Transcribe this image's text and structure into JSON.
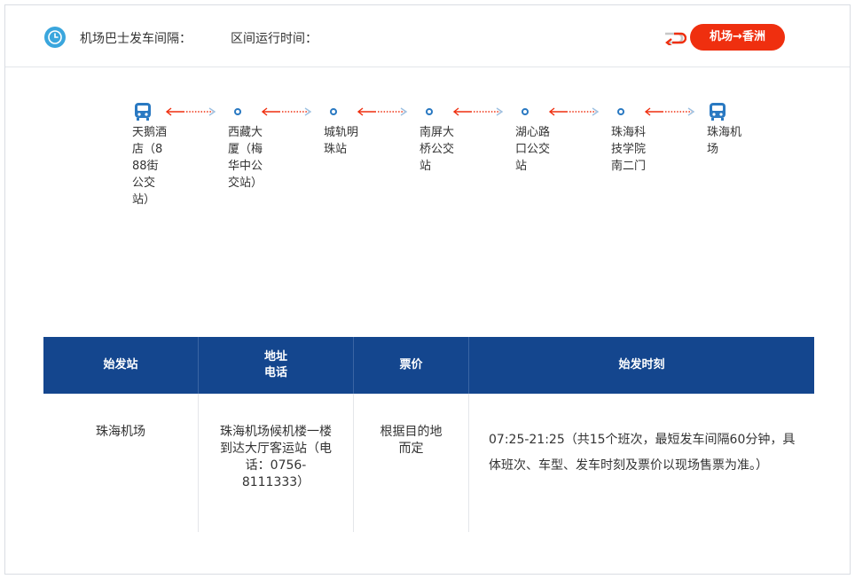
{
  "header": {
    "interval_label": "机场巴士发车间隔：",
    "runtime_label": "区间运行时间：",
    "direction_button": "机场→香洲",
    "icons": {
      "clock": "clock-icon",
      "swap": "swap-icon"
    }
  },
  "route": {
    "stops": [
      {
        "name": "天鹅酒店（888街公交站）",
        "type": "terminal"
      },
      {
        "name": "西藏大厦（梅华中公交站）",
        "type": "stop"
      },
      {
        "name": "城轨明珠站",
        "type": "stop"
      },
      {
        "name": "南屏大桥公交站",
        "type": "stop"
      },
      {
        "name": "湖心路口公交站",
        "type": "stop"
      },
      {
        "name": "珠海科技学院南二门",
        "type": "stop"
      },
      {
        "name": "珠海机场",
        "type": "terminal"
      }
    ]
  },
  "table": {
    "headers": [
      "始发站",
      "地址\n电话",
      "票价",
      "始发时刻"
    ],
    "rows": [
      {
        "origin": "珠海机场",
        "address": "珠海机场候机楼一楼到达大厅客运站（电话：0756-8111333）",
        "price": "根据目的地而定",
        "schedule": "07:25-21:25（共15个班次，最短发车间隔60分钟，具体班次、车型、发车时刻及票价以现场售票为准。）"
      }
    ]
  },
  "colors": {
    "accent_red": "#ef2f0f",
    "header_blue": "#14468e",
    "icon_blue": "#3aa6dd",
    "route_blue": "#2a79c2"
  }
}
